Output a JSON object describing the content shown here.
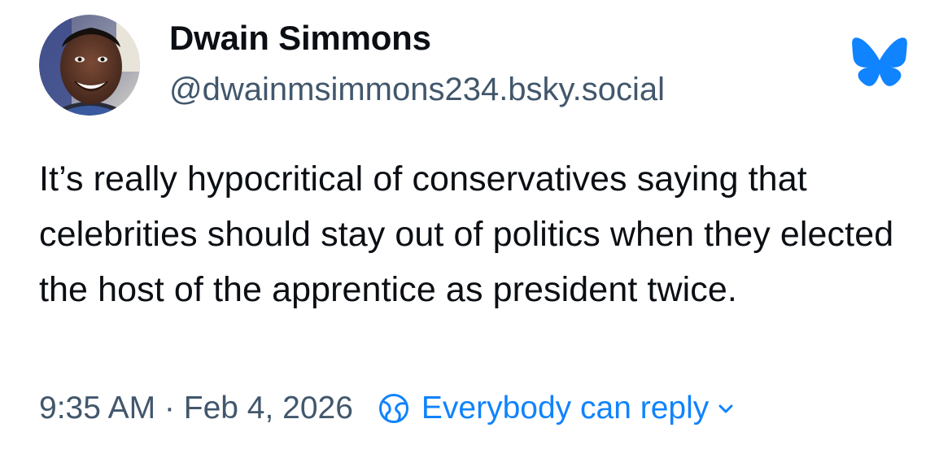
{
  "author": {
    "display_name": "Dwain Simmons",
    "handle": "@dwainmsimmons234.bsky.social",
    "avatar_icon": "profile-photo"
  },
  "app": {
    "logo_icon": "bluesky-butterfly-icon",
    "brand_color": "#1083fe"
  },
  "post": {
    "text": "It’s really hypocritical of conservatives saying that celebrities should stay out of politics when they elected the host of the apprentice as president twice."
  },
  "footer": {
    "timestamp": "9:35 AM · Feb 4, 2026",
    "reply_setting_label": "Everybody can reply",
    "reply_icon": "globe-icon",
    "chevron_icon": "chevron-down-icon"
  },
  "colors": {
    "text_primary": "#0b0f14",
    "text_secondary": "#42576c",
    "link": "#1083fe"
  }
}
